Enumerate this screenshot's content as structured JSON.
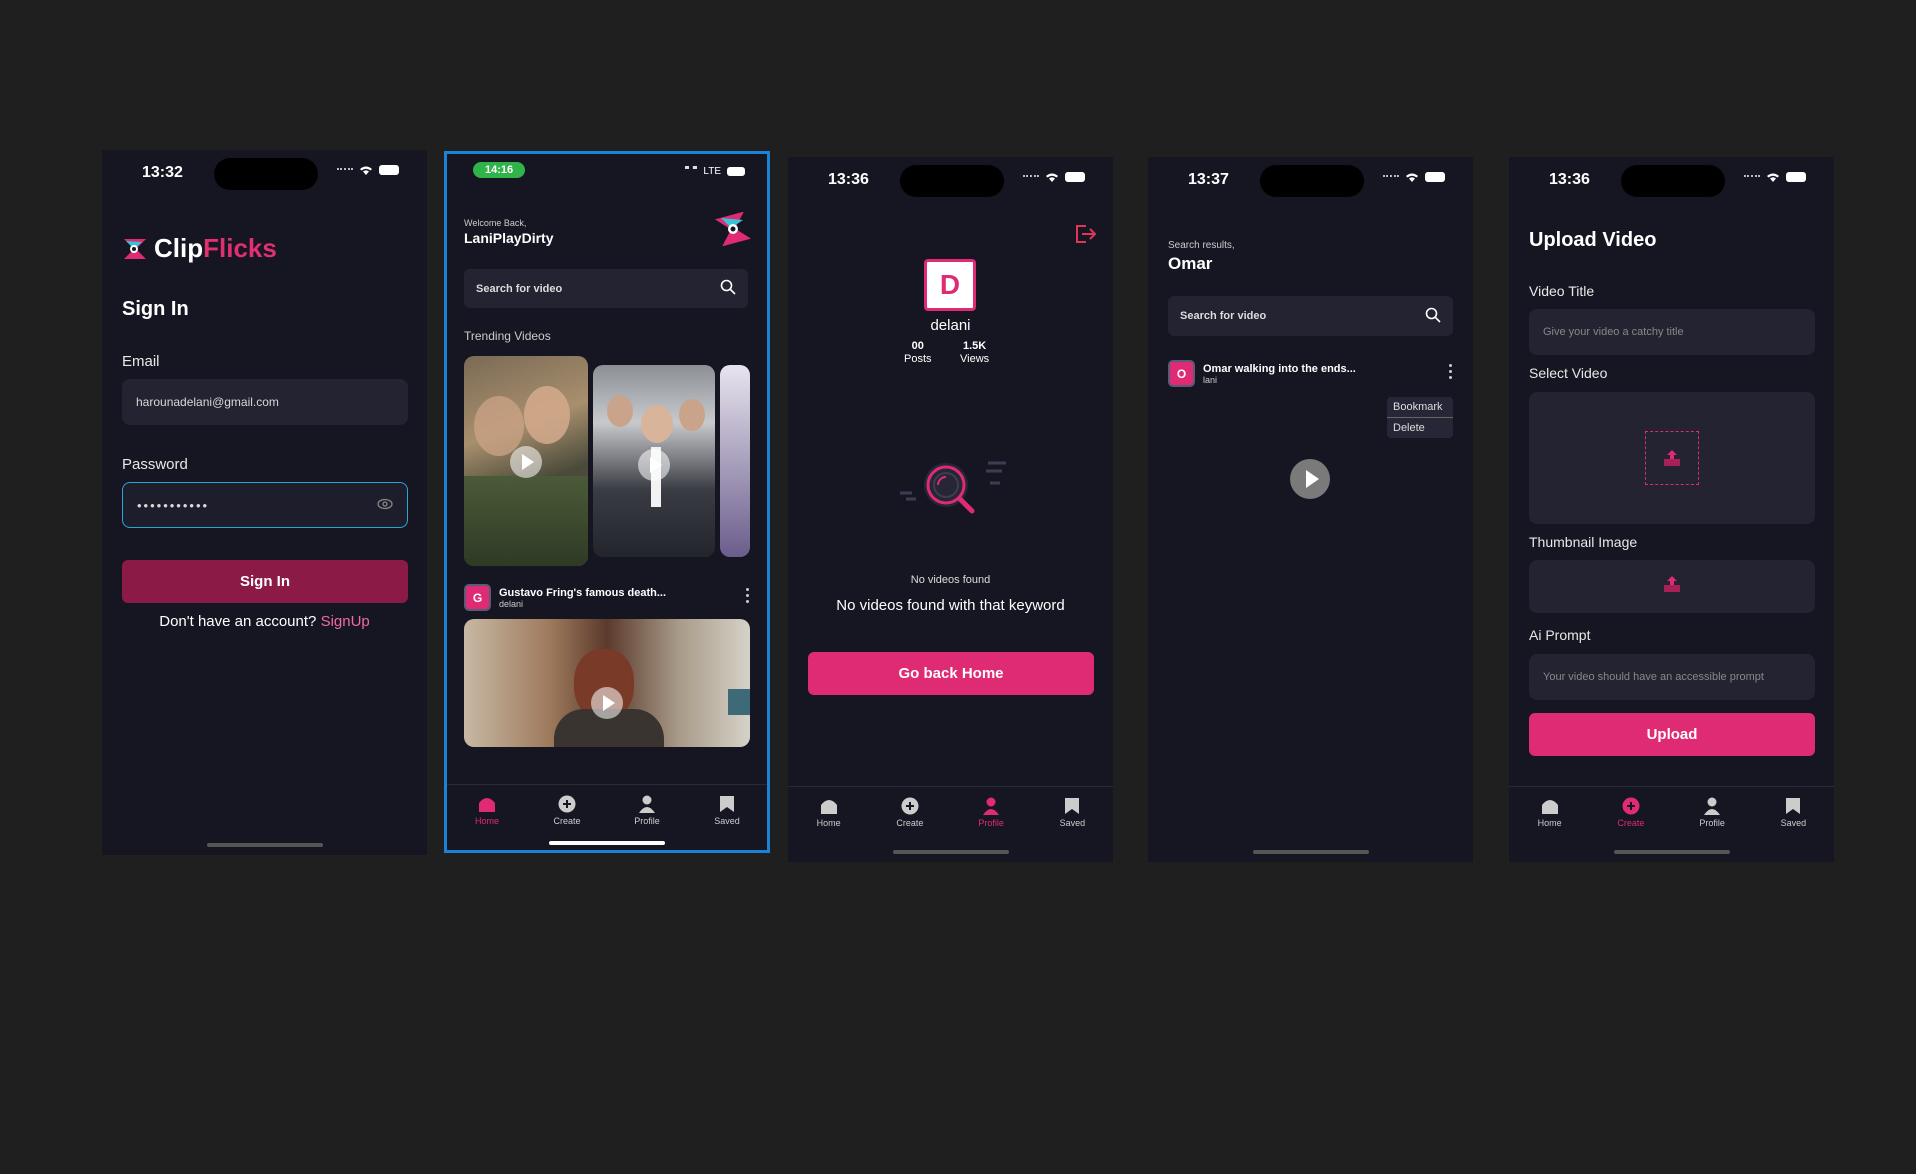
{
  "screens": {
    "signin": {
      "time": "13:32",
      "logo_part1": "Clip",
      "logo_part2": "Flicks",
      "title": "Sign In",
      "email_label": "Email",
      "email_value": "harounadelani@gmail.com",
      "password_label": "Password",
      "password_value": "•••••••••••",
      "signin_button": "Sign In",
      "no_account": "Don't have an account?",
      "signup_link": "SignUp"
    },
    "home": {
      "time": "14:16",
      "network": "LTE",
      "welcome_small": "Welcome Back,",
      "username": "LaniPlayDirty",
      "search_placeholder": "Search for video",
      "trending_label": "Trending Videos",
      "post": {
        "avatar": "G",
        "title": "Gustavo Fring's famous death...",
        "author": "delani"
      }
    },
    "profile": {
      "time": "13:36",
      "avatar": "D",
      "name": "delani",
      "posts_value": "00",
      "posts_label": "Posts",
      "views_value": "1.5K",
      "views_label": "Views",
      "empty_small": "No videos found",
      "empty_message": "No videos found with that keyword",
      "go_home_button": "Go back Home"
    },
    "search": {
      "time": "13:37",
      "results_label": "Search results,",
      "query": "Omar",
      "search_placeholder": "Search for video",
      "post": {
        "avatar": "O",
        "title": "Omar walking into the ends...",
        "author": "lani"
      },
      "menu": [
        "Bookmark",
        "Delete"
      ]
    },
    "upload": {
      "time": "13:36",
      "title": "Upload Video",
      "video_title_label": "Video Title",
      "video_title_placeholder": "Give your video a catchy title",
      "select_video_label": "Select Video",
      "thumbnail_label": "Thumbnail Image",
      "ai_prompt_label": "Ai Prompt",
      "ai_prompt_placeholder": "Your video should have an accessible prompt",
      "upload_button": "Upload"
    }
  },
  "tabs": [
    "Home",
    "Create",
    "Profile",
    "Saved"
  ],
  "colors": {
    "accent": "#de2b73",
    "background": "#161622",
    "field": "#232331",
    "focus": "#27a7d8",
    "highlight_border": "#1a83d6"
  }
}
